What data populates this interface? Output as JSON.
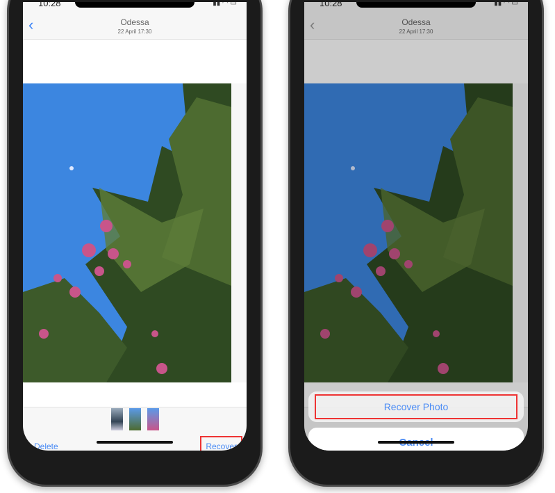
{
  "status": {
    "time": "10:28"
  },
  "left": {
    "nav": {
      "title": "Odessa",
      "subtitle": "22 April  17:30"
    },
    "toolbar": {
      "delete_label": "Delete",
      "recover_label": "Recover"
    }
  },
  "right": {
    "nav": {
      "title": "Odessa",
      "subtitle": "22 April  17:30"
    },
    "action_sheet": {
      "recover_photo_label": "Recover Photo",
      "cancel_label": "Cancel"
    }
  },
  "colors": {
    "accent": "#4b8cf5",
    "highlight": "#e33333",
    "sky": "#3c86e0"
  }
}
